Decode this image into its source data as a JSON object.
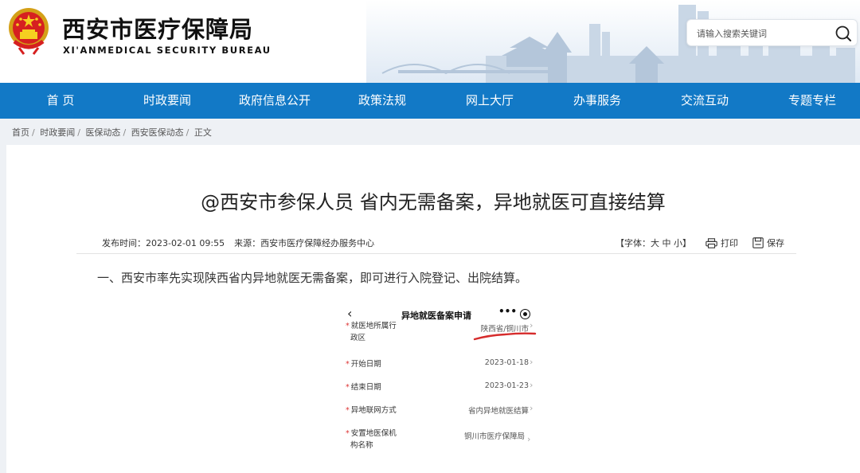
{
  "header": {
    "title": "西安市医疗保障局",
    "subtitle": "XI'ANMEDICAL SECURITY BUREAU",
    "emblem_icon": "national-emblem-icon"
  },
  "search": {
    "placeholder": "请输入搜索关键词",
    "icon": "search-icon"
  },
  "nav": {
    "items": [
      {
        "label": "首 页"
      },
      {
        "label": "时政要闻"
      },
      {
        "label": "政府信息公开"
      },
      {
        "label": "政策法规"
      },
      {
        "label": "网上大厅"
      },
      {
        "label": "办事服务"
      },
      {
        "label": "交流互动"
      },
      {
        "label": "专题专栏"
      }
    ],
    "color": "#1279c6"
  },
  "breadcrumb": {
    "items": [
      "首页",
      "时政要闻",
      "医保动态",
      "西安医保动态",
      "正文"
    ],
    "separator": "/"
  },
  "article": {
    "title": "@西安市参保人员 省内无需备案，异地就医可直接结算",
    "publish_time": "发布时间：2023-02-01 09:55",
    "source": "来源：西安市医疗保障经办服务中心",
    "font_size": {
      "prefix": "【字体：",
      "large": "大",
      "medium": "中",
      "small": "小",
      "suffix": "】"
    },
    "print_label": "打印",
    "save_label": "保存",
    "paragraph_1": "一、西安市率先实现陕西省内异地就医无需备案，即可进行入院登记、出院结算。"
  },
  "phone": {
    "back": "‹",
    "title": "异地就医备案申请",
    "more": "•••",
    "rows": [
      {
        "label_line1": "就医地所属行",
        "label_line2": "政区",
        "value": "陕西省/铜川市",
        "required": true
      },
      {
        "label_line1": "开始日期",
        "value": "2023-01-18",
        "required": true
      },
      {
        "label_line1": "结束日期",
        "value": "2023-01-23",
        "required": true
      },
      {
        "label_line1": "异地联网方式",
        "value": "省内异地就医结算",
        "required": true
      },
      {
        "label_line1": "安置地医保机",
        "label_line2": "构名称",
        "value": "铜川市医疗保障局",
        "required": true
      }
    ],
    "star": "*",
    "chevron": "›",
    "underline_color": "#d62c2c"
  }
}
